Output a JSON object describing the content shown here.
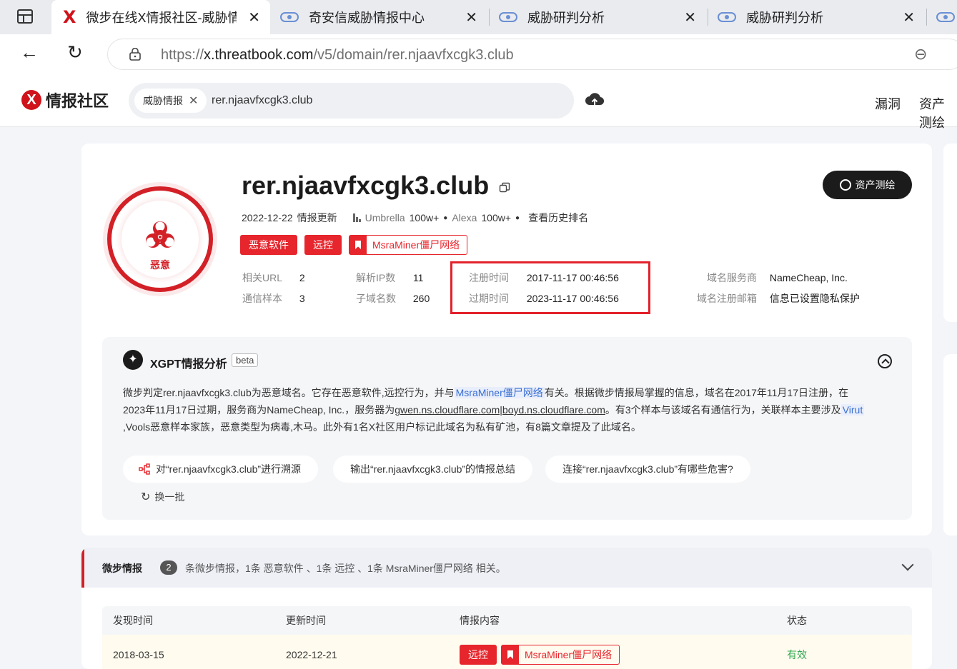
{
  "browser": {
    "tabs": [
      {
        "label": "微步在线X情报社区-威胁情",
        "active": true
      },
      {
        "label": "奇安信威胁情报中心",
        "active": false
      },
      {
        "label": "威胁研判分析",
        "active": false
      },
      {
        "label": "威胁研判分析",
        "active": false
      }
    ],
    "url_prefix": "https://",
    "url_domain": "x.threatbook.com",
    "url_path": "/v5/domain/rer.njaavfxcgk3.club"
  },
  "site": {
    "brand": "情报社区",
    "search_chip": "威胁情报",
    "search_value": "rer.njaavfxcgk3.club",
    "nav": [
      "漏洞",
      "资产测绘"
    ]
  },
  "domain": {
    "name": "rer.njaavfxcgk3.club",
    "verdict": "恶意",
    "update_date": "2022-12-22",
    "update_label": "情报更新",
    "umbrella_label": "Umbrella",
    "umbrella_value": "100w+",
    "alexa_label": "Alexa",
    "alexa_value": "100w+",
    "history_rank": "查看历史排名",
    "asset_button": "资产测绘",
    "tags": [
      "恶意软件",
      "远控"
    ],
    "family_tag": "MsraMiner僵尸网络"
  },
  "info": {
    "related_url_label": "相关URL",
    "related_url_value": "2",
    "resolve_ip_label": "解析IP数",
    "resolve_ip_value": "11",
    "reg_time_label": "注册时间",
    "reg_time_value": "2017-11-17 00:46:56",
    "registrar_label": "域名服务商",
    "registrar_value": "NameCheap, Inc.",
    "comm_sample_label": "通信样本",
    "comm_sample_value": "3",
    "subdomain_label": "子域名数",
    "subdomain_value": "260",
    "exp_time_label": "过期时间",
    "exp_time_value": "2023-11-17 00:46:56",
    "reg_email_label": "域名注册邮箱",
    "reg_email_value": "信息已设置隐私保护"
  },
  "xgpt": {
    "title": "XGPT情报分析",
    "beta": "beta",
    "p1a": "微步判定rer.njaavfxcgk3.club为恶意域名。它存在恶意软件,远控行为，并与",
    "p1hl": "MsraMiner僵尸网络",
    "p1b": "有关。根据微步情报局掌握的信息，域名在2017年11月17日注册，在",
    "p2a": "2023年11月17日过期，服务商为NameCheap, Inc.，服务器为",
    "p2ns": "gwen.ns.cloudflare.com|boyd.ns.cloudflare.com",
    "p2b": "。有3个样本与该域名有通信行为，关联样本主要涉及",
    "p2hl": "Virut",
    "p3": ",Vools恶意样本家族，恶意类型为病毒,木马。此外有1名X社区用户标记此域名为私有矿池，有8篇文章提及了此域名。",
    "questions": [
      "对“rer.njaavfxcgk3.club”进行溯源",
      "输出“rer.njaavfxcgk3.club”的情报总结",
      "连接“rer.njaavfxcgk3.club”有哪些危害?"
    ],
    "refresh": "换一批"
  },
  "intel": {
    "title": "微步情报",
    "count": "2",
    "desc": "条微步情报，1条 恶意软件 、1条 远控 、1条 MsraMiner僵尸网络 相关。",
    "headers": [
      "发现时间",
      "更新时间",
      "情报内容",
      "状态"
    ],
    "rows": [
      {
        "found": "2018-03-15",
        "updated": "2022-12-21",
        "tag": "远控",
        "family": "MsraMiner僵尸网络",
        "status": "有效"
      }
    ]
  },
  "colors": {
    "accent_red": "#e6252c",
    "status_green": "#32a853",
    "dark": "#1b1b1b"
  }
}
